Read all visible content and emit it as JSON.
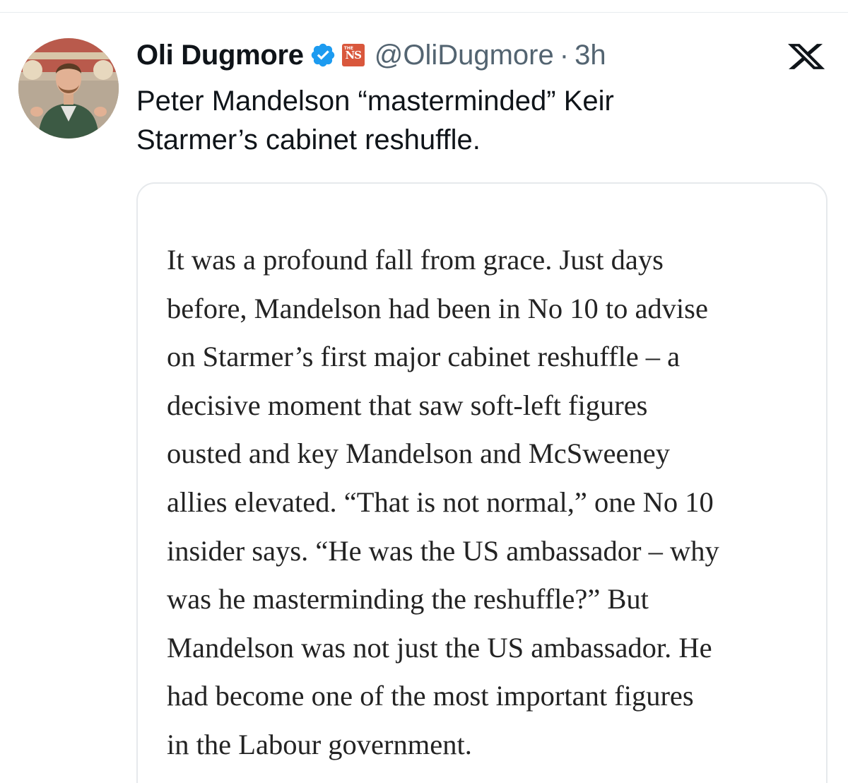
{
  "author": {
    "display_name": "Oli Dugmore",
    "handle": "@OliDugmore",
    "separator": "·",
    "time": "3h",
    "affiliate_badge_text": "NS",
    "affiliate_badge_small": "THE"
  },
  "icons": {
    "avatar": "profile-photo",
    "verified": "verified-badge-icon",
    "affiliate": "new-statesman-logo",
    "platform": "x-logo-icon"
  },
  "colors": {
    "verified": "#1d9bf0",
    "affiliate": "#d9573c",
    "text": "#0f1419",
    "secondary_text": "#536471"
  },
  "tweet": {
    "lines": [
      "Peter Mandelson “masterminded” Keir",
      "Starmer’s cabinet reshuffle."
    ]
  },
  "quote_image": {
    "lines": [
      "It was a profound fall from grace. Just days",
      "before, Mandelson had been in No 10 to advise",
      "on Starmer’s first major cabinet reshuffle – a",
      "decisive moment that saw soft-left figures",
      "ousted and key Mandelson and McSweeney",
      "allies elevated. “That is not normal,” one No 10",
      "insider says. “He was the US ambassador – why",
      "was he masterminding the reshuffle?” But",
      "Mandelson was not just the US ambassador. He",
      "had become one of the most important figures",
      "in the Labour government."
    ]
  }
}
